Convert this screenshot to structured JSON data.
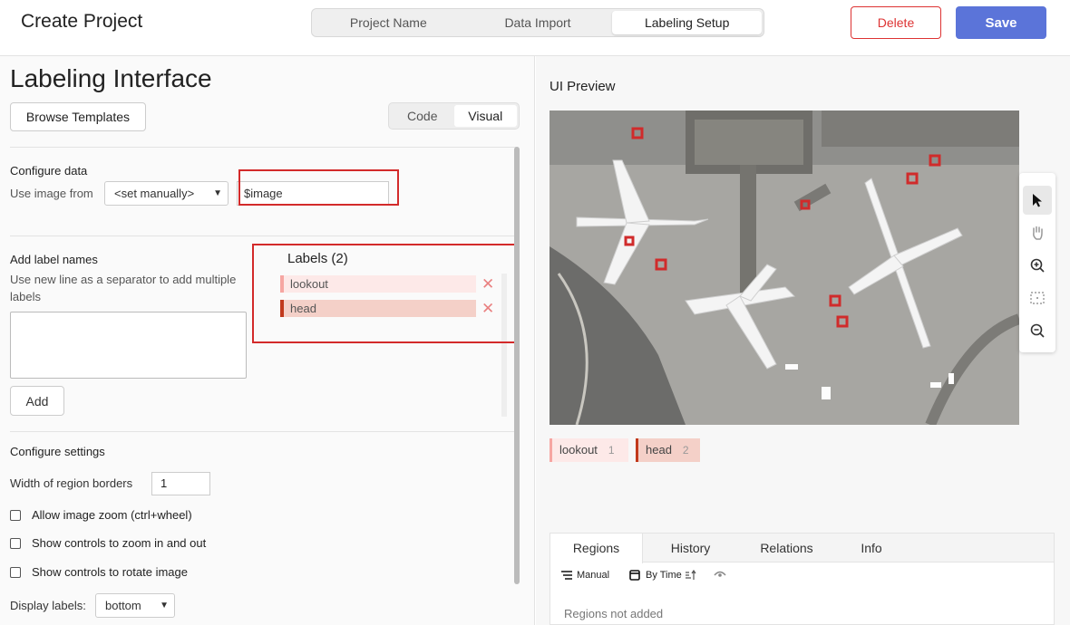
{
  "header": {
    "title": "Create Project",
    "steps": [
      "Project Name",
      "Data Import",
      "Labeling Setup"
    ],
    "active_step": "Labeling Setup",
    "delete_label": "Delete",
    "save_label": "Save",
    "colors": {
      "delete": "#dd3333",
      "save": "#5b74d9"
    }
  },
  "left": {
    "title": "Labeling Interface",
    "browse_label": "Browse Templates",
    "mode_tabs": [
      "Code",
      "Visual"
    ],
    "active_mode": "Visual",
    "configure_data": {
      "heading": "Configure data",
      "use_image_label": "Use image from",
      "source_select": "<set manually>",
      "source_value": "$image"
    },
    "label_names": {
      "heading": "Add label names",
      "hint": "Use new line as a separator to add multiple labels",
      "textarea_value": "",
      "add_label": "Add"
    },
    "labels_list": {
      "title": "Labels (2)",
      "items": [
        {
          "name": "lookout",
          "color": "#f6a6a2"
        },
        {
          "name": "head",
          "color": "#c1391c"
        }
      ],
      "remove_glyph": "✕"
    },
    "settings": {
      "heading": "Configure settings",
      "border_width_label": "Width of region borders",
      "border_width_value": "1",
      "checkboxes": [
        {
          "label": "Allow image zoom (ctrl+wheel)",
          "checked": false
        },
        {
          "label": "Show controls to zoom in and out",
          "checked": false
        },
        {
          "label": "Show controls to rotate image",
          "checked": false
        }
      ],
      "display_labels_label": "Display labels:",
      "display_labels_value": "bottom"
    }
  },
  "right": {
    "title": "UI Preview",
    "tools": [
      "pointer-icon",
      "hand-icon",
      "zoom-in-icon",
      "fit-icon",
      "zoom-out-icon"
    ],
    "labels": [
      {
        "name": "lookout",
        "shortcut": "1",
        "color": "#f6a6a2"
      },
      {
        "name": "head",
        "shortcut": "2",
        "color": "#c1391c"
      }
    ],
    "panel": {
      "tabs": [
        "Regions",
        "History",
        "Relations",
        "Info"
      ],
      "active_tab": "Regions",
      "manual_label": "Manual",
      "sort_label": "By Time",
      "empty_text": "Regions not added"
    }
  }
}
